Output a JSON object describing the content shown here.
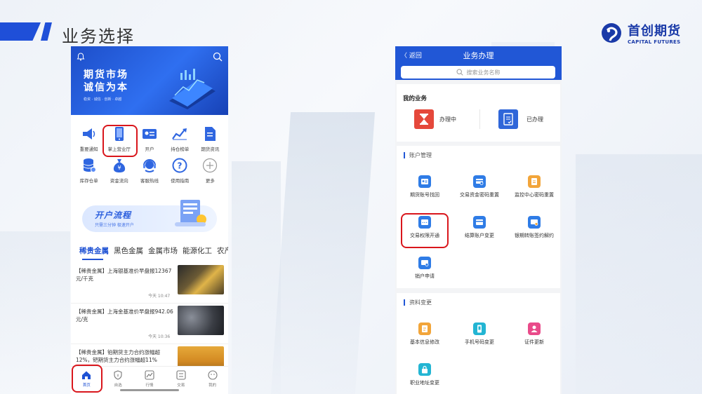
{
  "header": {
    "title": "业务选择",
    "logo_cn": "首创期货",
    "logo_en": "CAPITAL FUTURES",
    "brand_color": "#1f4fd8"
  },
  "left_app": {
    "banner": {
      "line1": "期货市场",
      "line2": "诚信为本",
      "sub": "稳资 · 诚信 · 创新 · 卓越"
    },
    "grid": [
      {
        "label": "重要通知",
        "icon": "megaphone-icon"
      },
      {
        "label": "掌上营业厅",
        "icon": "phone-icon",
        "highlighted": true
      },
      {
        "label": "开户",
        "icon": "id-card-icon"
      },
      {
        "label": "持仓榜单",
        "icon": "chart-icon"
      },
      {
        "label": "期货资讯",
        "icon": "document-icon"
      },
      {
        "label": "库存仓单",
        "icon": "database-icon"
      },
      {
        "label": "资金流向",
        "icon": "money-bag-icon"
      },
      {
        "label": "客服热线",
        "icon": "headset-icon"
      },
      {
        "label": "使用指南",
        "icon": "question-icon"
      },
      {
        "label": "更多",
        "icon": "plus-icon"
      }
    ],
    "flow": {
      "title": "开户流程",
      "sub": "只需三分钟  极速开户"
    },
    "tabs": [
      "稀贵金属",
      "黑色金属",
      "金属市场",
      "能源化工",
      "农产"
    ],
    "news": [
      {
        "text": "【稀贵金属】上海银基准价早盘报12367元/千克",
        "time": "今天 10:47"
      },
      {
        "text": "【稀贵金属】上海金基准价早盘报942.06元/克",
        "time": "今天 10:36"
      },
      {
        "text": "【稀贵金属】铂期货主力合约涨幅超12%，钯期货主力合约涨幅超11%",
        "time": ""
      }
    ],
    "nav": [
      "首页",
      "自选",
      "行情",
      "交易",
      "我的"
    ]
  },
  "right_app": {
    "back": "〈 返回",
    "title": "业务办理",
    "search_placeholder": "搜索业务名称",
    "my_business": {
      "title": "我的业务",
      "in_progress": "办理中",
      "done": "已办理"
    },
    "account_mgmt": {
      "title": "账户管理",
      "items": [
        "期货账号找回",
        "交易资金密码重置",
        "监控中心密码重置",
        "交易权限开通",
        "结算账户变更",
        "银期转账签约解约",
        "销户申请"
      ]
    },
    "data_change": {
      "title": "资料变更",
      "items": [
        "基本信息修改",
        "手机号码变更",
        "证件更新",
        "职业地址变更"
      ]
    }
  }
}
